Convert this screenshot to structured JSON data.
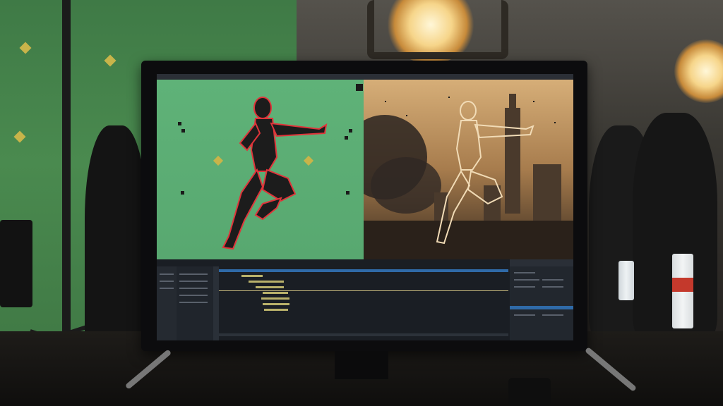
{
  "scene": {
    "description_type": "vfx-studio-photo",
    "colors": {
      "green_screen": "#4a8a4f",
      "key_green": "#5fb278",
      "marker_yellow": "#c8b44a",
      "roto_outline": "#e0343a",
      "warm_light": "#f6d58a",
      "track_blue": "#2f6aa8"
    },
    "monitor": {
      "left_viewer": {
        "content": "keyed-actor-green-screen",
        "outline_color": "#e0343a"
      },
      "right_viewer": {
        "content": "composite-ruined-city",
        "figure_color": "#f1dbb6"
      }
    },
    "icons": [
      "film-light-icon",
      "c-stand-icon",
      "monitor-icon"
    ]
  }
}
